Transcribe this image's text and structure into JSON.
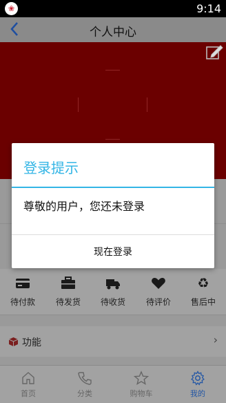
{
  "status_bar": {
    "time": "9:14",
    "app_icon": "app-badge-icon"
  },
  "header": {
    "title": "个人中心",
    "back_icon": "chevron-left-icon"
  },
  "banner": {
    "color": "#6b0000",
    "edit_icon": "edit-icon"
  },
  "orders": [
    {
      "label": "待付款",
      "icon": "card-icon"
    },
    {
      "label": "待发货",
      "icon": "briefcase-icon"
    },
    {
      "label": "待收货",
      "icon": "truck-icon"
    },
    {
      "label": "待评价",
      "icon": "heart-icon"
    },
    {
      "label": "售后中",
      "icon": "recycle-icon"
    }
  ],
  "functions": {
    "label": "功能",
    "arrow": "›",
    "icon": "box-icon"
  },
  "bottom_nav": [
    {
      "label": "首页",
      "icon": "home-icon",
      "active": false
    },
    {
      "label": "分类",
      "icon": "phone-icon",
      "active": false
    },
    {
      "label": "购物车",
      "icon": "star-icon",
      "active": false
    },
    {
      "label": "我的",
      "icon": "gear-icon",
      "active": true
    }
  ],
  "dialog": {
    "title": "登录提示",
    "message": "尊敬的用户，您还未登录",
    "button": "现在登录",
    "accent": "#33b5e5"
  },
  "colors": {
    "nav_active": "#2457a5"
  }
}
